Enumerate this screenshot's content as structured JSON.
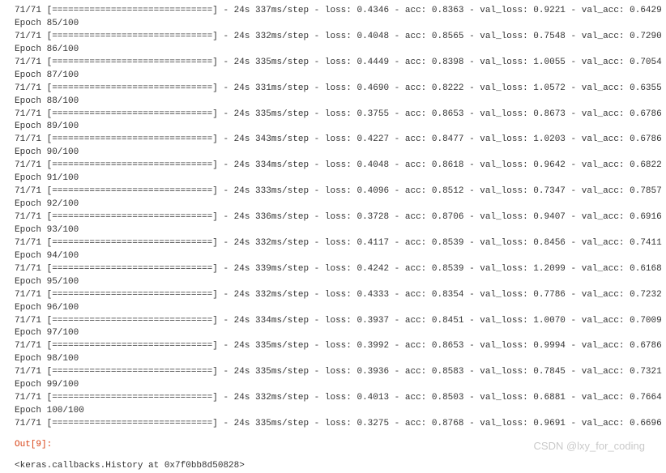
{
  "progress": {
    "steps_done": "71",
    "steps_total": "71",
    "bar": "[==============================]",
    "dash": " - "
  },
  "epochs": [
    {
      "epoch_label": "",
      "time": "24s 337ms/step",
      "loss": "0.4346",
      "acc": "0.8363",
      "val_loss": "0.9221",
      "val_acc": "0.6429"
    },
    {
      "epoch_label": "Epoch 85/100",
      "time": "24s 332ms/step",
      "loss": "0.4048",
      "acc": "0.8565",
      "val_loss": "0.7548",
      "val_acc": "0.7290"
    },
    {
      "epoch_label": "Epoch 86/100",
      "time": "24s 335ms/step",
      "loss": "0.4449",
      "acc": "0.8398",
      "val_loss": "1.0055",
      "val_acc": "0.7054"
    },
    {
      "epoch_label": "Epoch 87/100",
      "time": "24s 331ms/step",
      "loss": "0.4690",
      "acc": "0.8222",
      "val_loss": "1.0572",
      "val_acc": "0.6355"
    },
    {
      "epoch_label": "Epoch 88/100",
      "time": "24s 335ms/step",
      "loss": "0.3755",
      "acc": "0.8653",
      "val_loss": "0.8673",
      "val_acc": "0.6786"
    },
    {
      "epoch_label": "Epoch 89/100",
      "time": "24s 343ms/step",
      "loss": "0.4227",
      "acc": "0.8477",
      "val_loss": "1.0203",
      "val_acc": "0.6786"
    },
    {
      "epoch_label": "Epoch 90/100",
      "time": "24s 334ms/step",
      "loss": "0.4048",
      "acc": "0.8618",
      "val_loss": "0.9642",
      "val_acc": "0.6822"
    },
    {
      "epoch_label": "Epoch 91/100",
      "time": "24s 333ms/step",
      "loss": "0.4096",
      "acc": "0.8512",
      "val_loss": "0.7347",
      "val_acc": "0.7857"
    },
    {
      "epoch_label": "Epoch 92/100",
      "time": "24s 336ms/step",
      "loss": "0.3728",
      "acc": "0.8706",
      "val_loss": "0.9407",
      "val_acc": "0.6916"
    },
    {
      "epoch_label": "Epoch 93/100",
      "time": "24s 332ms/step",
      "loss": "0.4117",
      "acc": "0.8539",
      "val_loss": "0.8456",
      "val_acc": "0.7411"
    },
    {
      "epoch_label": "Epoch 94/100",
      "time": "24s 339ms/step",
      "loss": "0.4242",
      "acc": "0.8539",
      "val_loss": "1.2099",
      "val_acc": "0.6168"
    },
    {
      "epoch_label": "Epoch 95/100",
      "time": "24s 332ms/step",
      "loss": "0.4333",
      "acc": "0.8354",
      "val_loss": "0.7786",
      "val_acc": "0.7232"
    },
    {
      "epoch_label": "Epoch 96/100",
      "time": "24s 334ms/step",
      "loss": "0.3937",
      "acc": "0.8451",
      "val_loss": "1.0070",
      "val_acc": "0.7009"
    },
    {
      "epoch_label": "Epoch 97/100",
      "time": "24s 335ms/step",
      "loss": "0.3992",
      "acc": "0.8653",
      "val_loss": "0.9994",
      "val_acc": "0.6786"
    },
    {
      "epoch_label": "Epoch 98/100",
      "time": "24s 335ms/step",
      "loss": "0.3936",
      "acc": "0.8583",
      "val_loss": "0.7845",
      "val_acc": "0.7321"
    },
    {
      "epoch_label": "Epoch 99/100",
      "time": "24s 332ms/step",
      "loss": "0.4013",
      "acc": "0.8503",
      "val_loss": "0.6881",
      "val_acc": "0.7664"
    },
    {
      "epoch_label": "Epoch 100/100",
      "time": "24s 335ms/step",
      "loss": "0.3275",
      "acc": "0.8768",
      "val_loss": "0.9691",
      "val_acc": "0.6696"
    }
  ],
  "out_marker": "Out[9]:",
  "history_repr": "<keras.callbacks.History at 0x7f0bb8d50828>",
  "watermark": "CSDN @lxy_for_coding"
}
